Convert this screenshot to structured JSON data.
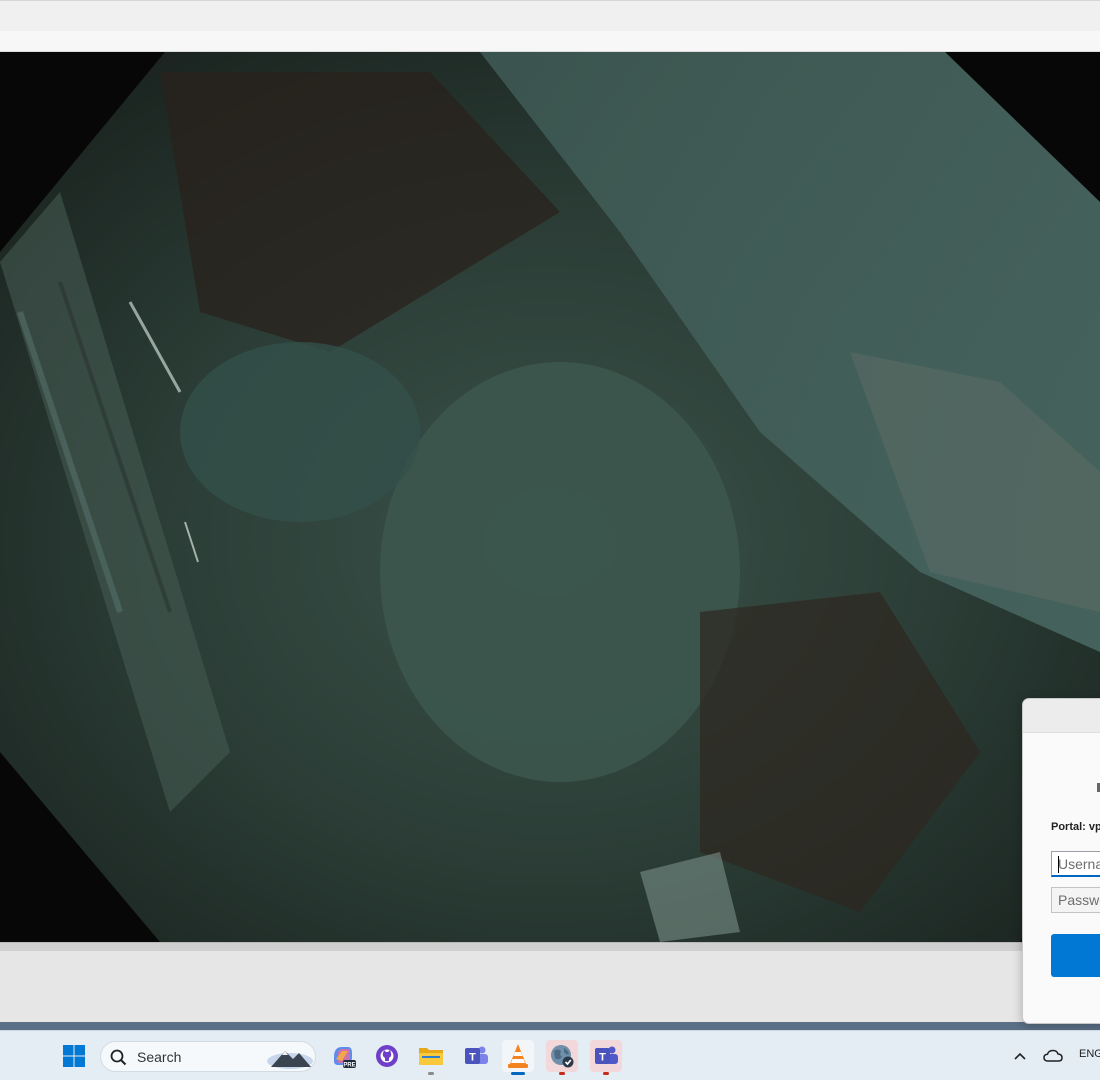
{
  "video": {
    "description_hidden": ""
  },
  "vpn": {
    "portal_label": "Portal: vp",
    "username_placeholder": "Userna",
    "password_placeholder": "Passwo",
    "connect_label": ""
  },
  "taskbar": {
    "search_label": "Search",
    "tray_language": "ENG",
    "apps": [
      "start-icon",
      "copilot-icon",
      "github-desktop-icon",
      "file-explorer-icon",
      "teams-icon",
      "vlc-icon",
      "vpn-globe-icon",
      "teams-classic-icon"
    ]
  },
  "colors": {
    "accent": "#0078d4",
    "taskbar_bg": "#e4ecf4",
    "flag": "#c42b1c"
  }
}
